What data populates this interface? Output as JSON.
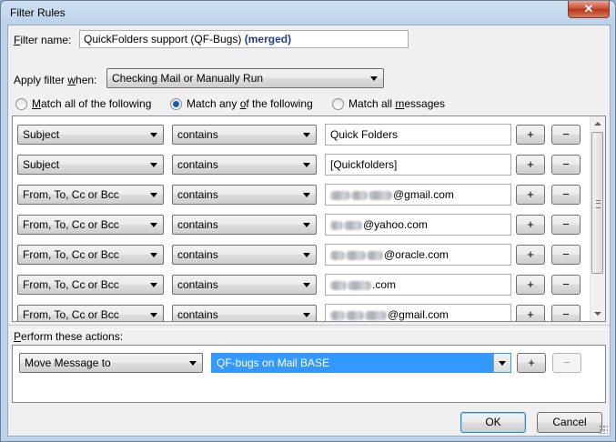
{
  "window": {
    "title": "Filter Rules",
    "close_glyph": "✕"
  },
  "filter_name": {
    "label_u": "F",
    "label_rest": "ilter name:",
    "value": "QuickFolders support (QF-Bugs)",
    "badge": "(merged)"
  },
  "apply_when": {
    "label_pre": "Apply filter ",
    "label_u": "w",
    "label_post": "hen:",
    "selected": "Checking Mail or Manually Run"
  },
  "match": {
    "all": {
      "pre": "",
      "u": "M",
      "post": "atch all of the following",
      "checked": false
    },
    "any": {
      "pre": "Match any ",
      "u": "o",
      "post": "f the following",
      "checked": true
    },
    "all_messages": {
      "pre": "Match all ",
      "u": "m",
      "post": "essages",
      "checked": false
    }
  },
  "rules": [
    {
      "field": "Subject",
      "op": "contains",
      "value": "Quick Folders",
      "redacted": false
    },
    {
      "field": "Subject",
      "op": "contains",
      "value": "[Quickfolders]",
      "redacted": false
    },
    {
      "field": "From, To, Cc or Bcc",
      "op": "contains",
      "value": "@gmail.com",
      "redacted": true
    },
    {
      "field": "From, To, Cc or Bcc",
      "op": "contains",
      "value": "@yahoo.com",
      "redacted": true
    },
    {
      "field": "From, To, Cc or Bcc",
      "op": "contains",
      "value": "@oracle.com",
      "redacted": true
    },
    {
      "field": "From, To, Cc or Bcc",
      "op": "contains",
      "value": ".com",
      "redacted": true
    },
    {
      "field": "From, To, Cc or Bcc",
      "op": "contains",
      "value": "@gmail.com",
      "redacted": true
    }
  ],
  "rule_buttons": {
    "add": "+",
    "remove": "−"
  },
  "actions": {
    "label_u": "P",
    "label_rest": "erform these actions:",
    "action": "Move Message to",
    "target": "QF-bugs on Mail BASE"
  },
  "buttons": {
    "ok": "OK",
    "cancel": "Cancel"
  }
}
